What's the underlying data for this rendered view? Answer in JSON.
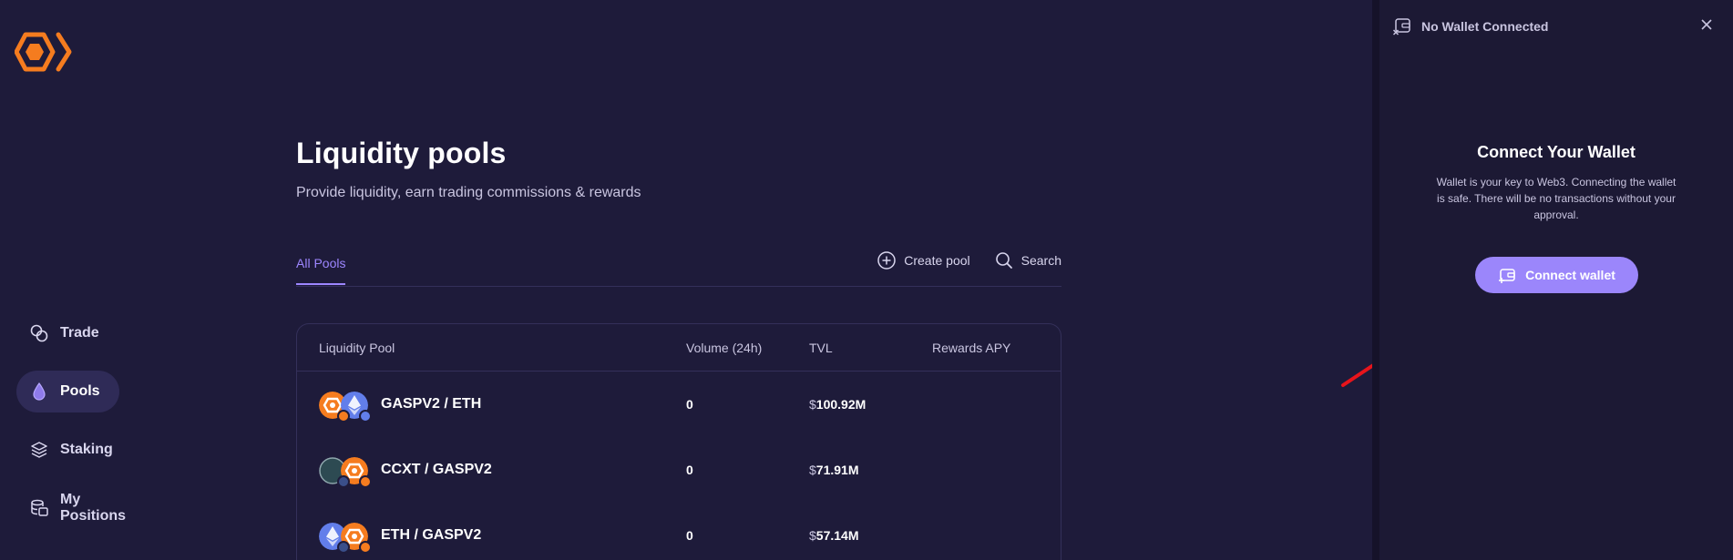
{
  "sidebar": {
    "items": [
      {
        "label": "Trade",
        "icon": "trade-icon"
      },
      {
        "label": "Pools",
        "icon": "drop-icon",
        "active": true
      },
      {
        "label": "Staking",
        "icon": "layers-icon"
      },
      {
        "label": "My Positions",
        "icon": "database-icon"
      }
    ]
  },
  "header": {
    "title": "Liquidity pools",
    "subtitle": "Provide liquidity, earn trading commissions & rewards"
  },
  "tabs": {
    "all_pools": "All Pools",
    "create_pool": "Create pool",
    "search": "Search"
  },
  "table": {
    "columns": {
      "pool": "Liquidity Pool",
      "volume": "Volume (24h)",
      "tvl": "TVL",
      "apy": "Rewards APY"
    },
    "rows": [
      {
        "pair": "GASPV2 / ETH",
        "volume": "0",
        "tvl_prefix": "$",
        "tvl": "100.92M",
        "apy": ""
      },
      {
        "pair": "CCXT / GASPV2",
        "volume": "0",
        "tvl_prefix": "$",
        "tvl": "71.91M",
        "apy": ""
      },
      {
        "pair": "ETH / GASPV2",
        "volume": "0",
        "tvl_prefix": "$",
        "tvl": "57.14M",
        "apy": ""
      }
    ]
  },
  "wallet_panel": {
    "status": "No Wallet Connected",
    "title": "Connect Your Wallet",
    "description": "Wallet is your key to Web3. Connecting the wallet is safe. There will be no transactions without your approval.",
    "button": "Connect wallet"
  },
  "colors": {
    "background": "#1e1b3a",
    "accent": "#9b86fb",
    "brand_orange": "#f57c1f",
    "annotation_arrow": "#e8141b"
  }
}
